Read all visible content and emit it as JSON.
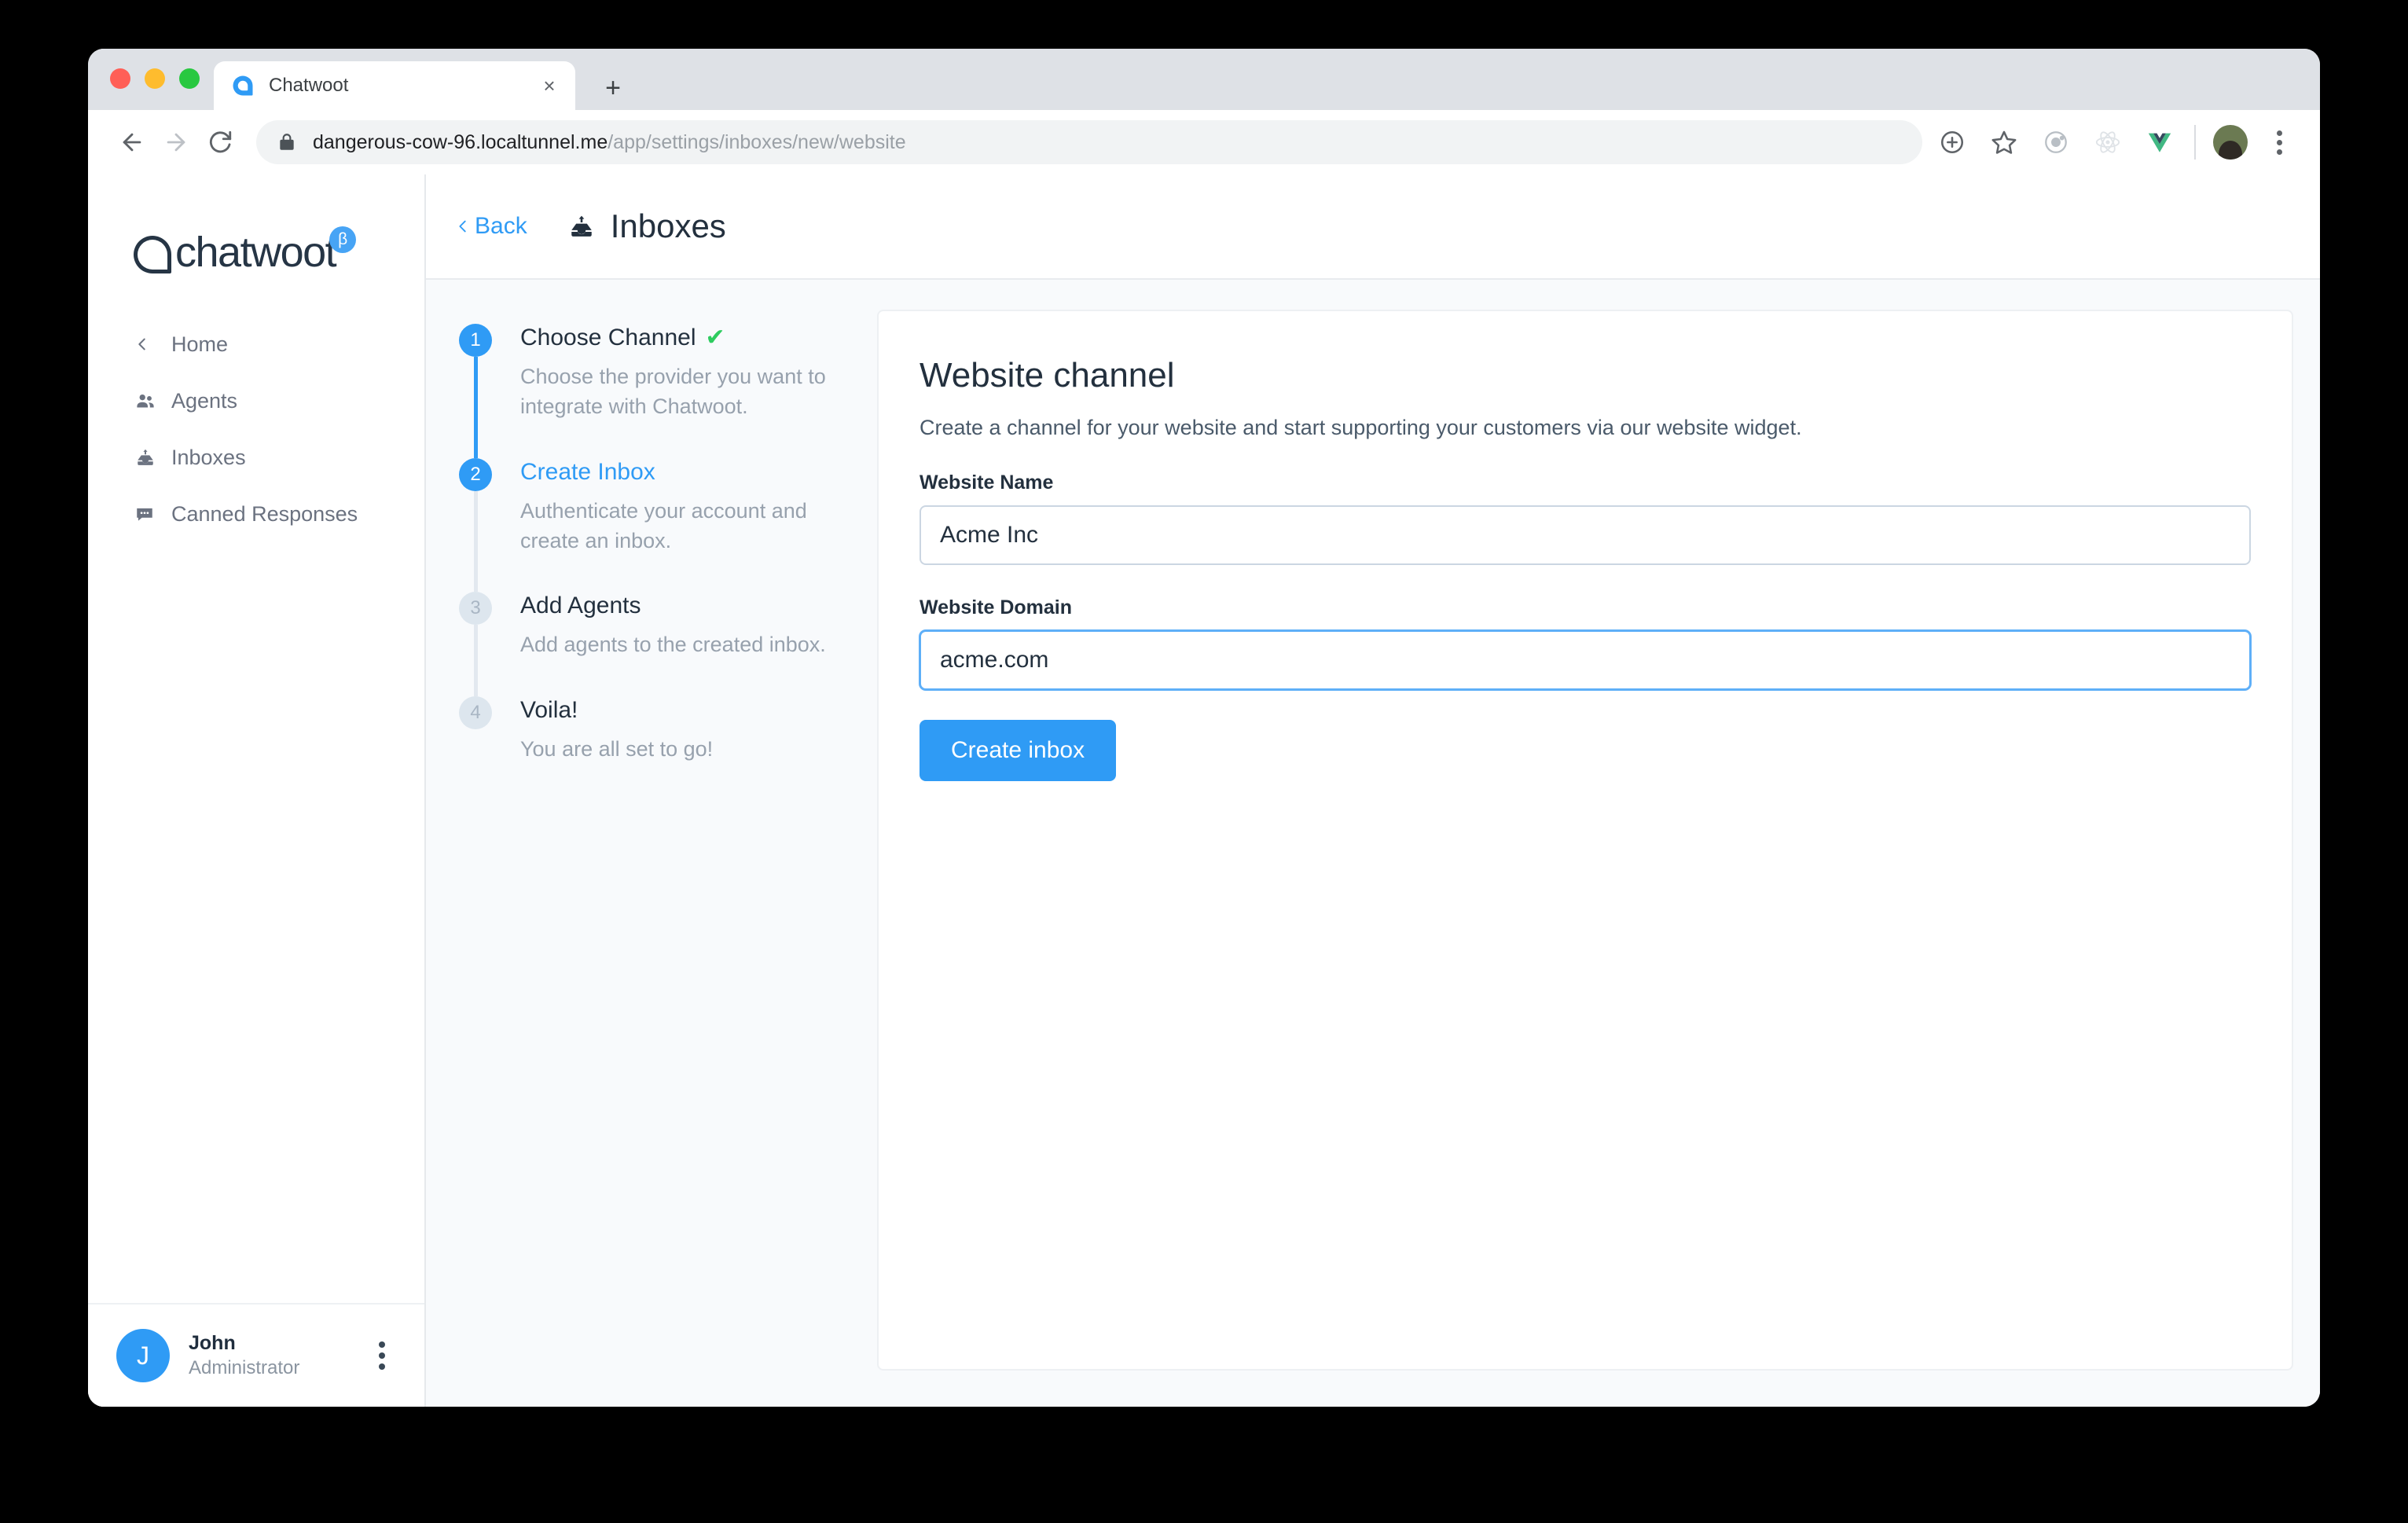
{
  "browser": {
    "tab": {
      "title": "Chatwoot",
      "favicon": "chatwoot-bubble-icon",
      "close_label": "×"
    },
    "new_tab_label": "+",
    "nav": {
      "back": "←",
      "forward": "→",
      "reload": "⟳"
    },
    "omnibox": {
      "lock_icon": "lock-icon",
      "url_host": "dangerous-cow-96.localtunnel.me",
      "url_path": "/app/settings/inboxes/new/website"
    },
    "actions": [
      {
        "name": "add-extension-icon",
        "label": "⊕"
      },
      {
        "name": "bookmark-star-icon",
        "label": "☆"
      },
      {
        "name": "orbit-extension-icon",
        "label": ""
      },
      {
        "name": "react-devtools-icon",
        "label": ""
      },
      {
        "name": "vue-devtools-icon",
        "label": ""
      }
    ]
  },
  "sidebar": {
    "brand": {
      "wordmark": "chatwoot",
      "badge": "β"
    },
    "items": [
      {
        "label": "Home",
        "icon": "chevron-left-icon"
      },
      {
        "label": "Agents",
        "icon": "people-icon"
      },
      {
        "label": "Inboxes",
        "icon": "inbox-icon"
      },
      {
        "label": "Canned Responses",
        "icon": "chat-bubble-icon"
      }
    ],
    "user": {
      "initial": "J",
      "name": "John",
      "role": "Administrator"
    }
  },
  "header": {
    "back_label": "Back",
    "title": "Inboxes",
    "title_icon": "inbox-icon"
  },
  "stepper": {
    "steps": [
      {
        "number": "1",
        "title": "Choose Channel",
        "description": "Choose the provider you want to integrate with Chatwoot.",
        "state": "done",
        "check": "✔"
      },
      {
        "number": "2",
        "title": "Create Inbox",
        "description": "Authenticate your account and create an inbox.",
        "state": "active"
      },
      {
        "number": "3",
        "title": "Add Agents",
        "description": "Add agents to the created inbox.",
        "state": "todo"
      },
      {
        "number": "4",
        "title": "Voila!",
        "description": "You are all set to go!",
        "state": "todo"
      }
    ]
  },
  "channel_form": {
    "heading": "Website channel",
    "subheading": "Create a channel for your website and start supporting your customers via our website widget.",
    "name_label": "Website Name",
    "name_value": "Acme Inc",
    "name_placeholder": "",
    "domain_label": "Website Domain",
    "domain_value": "acme.com",
    "domain_placeholder": "",
    "submit_label": "Create inbox"
  },
  "colors": {
    "accent": "#2f9bf5",
    "success": "#2ecc5f",
    "text_dark": "#23303e",
    "text_muted": "#97a1ad",
    "page_bg": "#f8fafc"
  }
}
